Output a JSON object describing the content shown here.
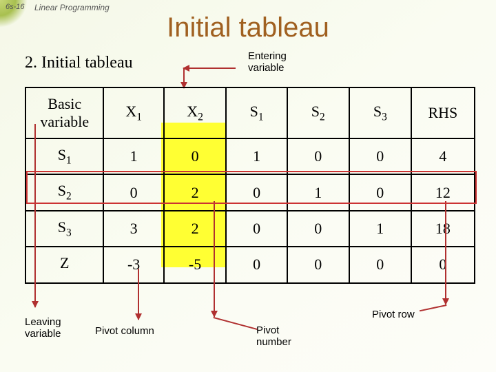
{
  "page_number": "6s-16",
  "chapter": "Linear Programming",
  "title": "Initial tableau",
  "subtitle": "2. Initial tableau",
  "labels": {
    "entering": "Entering\nvariable",
    "leaving": "Leaving\nvariable",
    "pivot_column": "Pivot column",
    "pivot_number": "Pivot\nnumber",
    "pivot_row": "Pivot row"
  },
  "headers": {
    "basic": "Basic variable",
    "x1": "X",
    "x1_sub": "1",
    "x2": "X",
    "x2_sub": "2",
    "s1": "S",
    "s1_sub": "1",
    "s2": "S",
    "s2_sub": "2",
    "s3": "S",
    "s3_sub": "3",
    "rhs": "RHS"
  },
  "rows": [
    {
      "basic": "S",
      "basic_sub": "1",
      "x1": "1",
      "x2": "0",
      "s1": "1",
      "s2": "0",
      "s3": "0",
      "rhs": "4"
    },
    {
      "basic": "S",
      "basic_sub": "2",
      "x1": "0",
      "x2": "2",
      "s1": "0",
      "s2": "1",
      "s3": "0",
      "rhs": "12"
    },
    {
      "basic": "S",
      "basic_sub": "3",
      "x1": "3",
      "x2": "2",
      "s1": "0",
      "s2": "0",
      "s3": "1",
      "rhs": "18"
    },
    {
      "basic": "Z",
      "basic_sub": "",
      "x1": "-3",
      "x2": "-5",
      "s1": "0",
      "s2": "0",
      "s3": "0",
      "rhs": "0"
    }
  ],
  "chart_data": {
    "type": "table",
    "title": "Initial tableau",
    "columns": [
      "Basic variable",
      "X1",
      "X2",
      "S1",
      "S2",
      "S3",
      "RHS"
    ],
    "rows": [
      [
        "S1",
        1,
        0,
        1,
        0,
        0,
        4
      ],
      [
        "S2",
        0,
        2,
        0,
        1,
        0,
        12
      ],
      [
        "S3",
        3,
        2,
        0,
        0,
        1,
        18
      ],
      [
        "Z",
        -3,
        -5,
        0,
        0,
        0,
        0
      ]
    ],
    "pivot_column": "X2",
    "pivot_row": "S2",
    "pivot_value": 2,
    "entering_variable": "X2",
    "leaving_variable": "S2"
  }
}
